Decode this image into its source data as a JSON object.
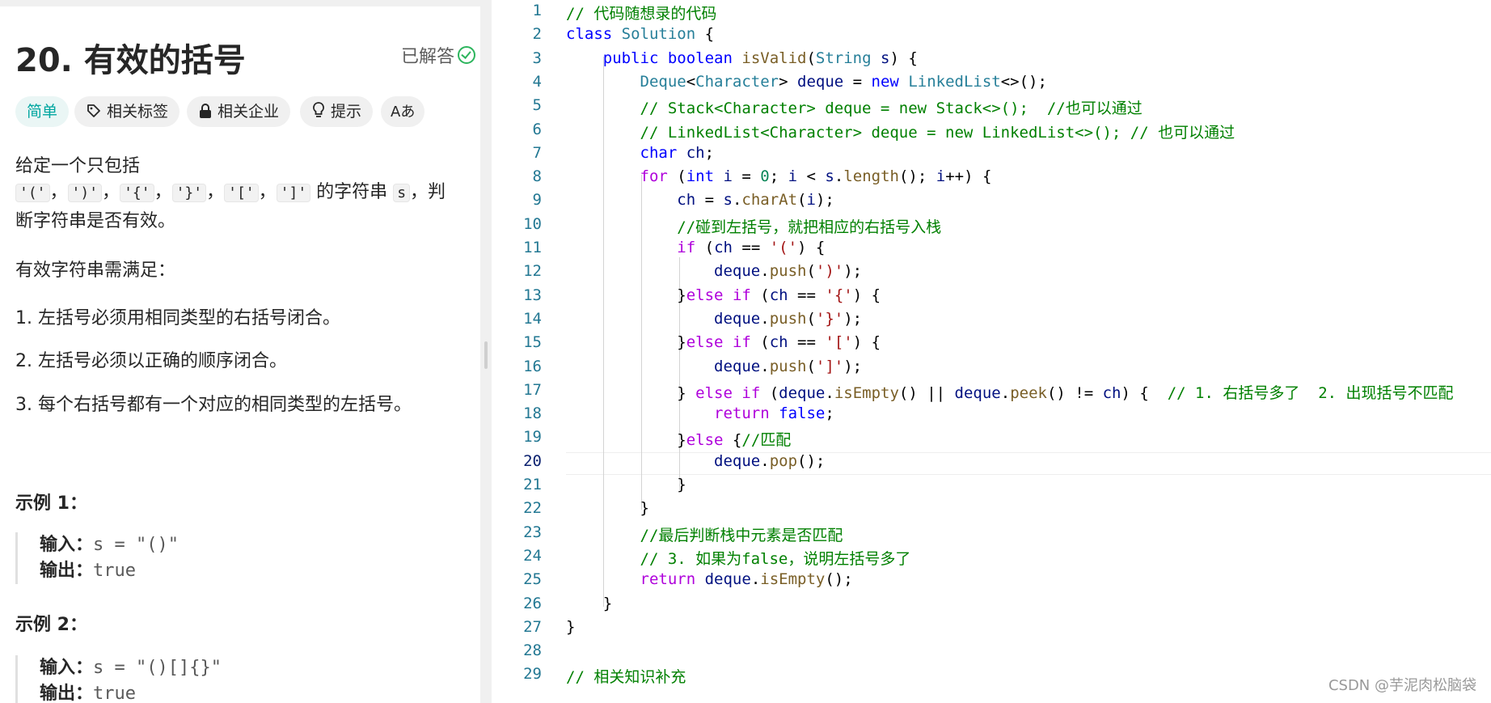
{
  "problem": {
    "title": "20. 有效的括号",
    "solved_label": "已解答",
    "tags": [
      {
        "label": "简单",
        "icon": "difficulty-easy"
      },
      {
        "label": "相关标签",
        "icon": "tag-icon"
      },
      {
        "label": "相关企业",
        "icon": "lock-icon"
      },
      {
        "label": "提示",
        "icon": "bulb-icon"
      },
      {
        "label": "Aあ",
        "icon": "translate-icon"
      }
    ],
    "desc_line1": "给定一个只包括",
    "chars": [
      "'('",
      "')'",
      "'{'",
      "'}'",
      "'['",
      "']'"
    ],
    "sep": "，",
    "desc_string": "的字符串",
    "desc_s": "s",
    "desc_judge": "，判",
    "desc_line3": "断字符串是否有效。",
    "requirement_title": "有效字符串需满足：",
    "rules": [
      "1. 左括号必须用相同类型的右括号闭合。",
      "2. 左括号必须以正确的顺序闭合。",
      "3. 每个右括号都有一个对应的相同类型的左括号。"
    ],
    "examples": [
      {
        "title": "示例 1：",
        "input_label": "输入：",
        "input": "s = \"()\"",
        "output_label": "输出：",
        "output": "true"
      },
      {
        "title": "示例 2：",
        "input_label": "输入：",
        "input": "s = \"()[]{}\"",
        "output_label": "输出：",
        "output": "true"
      }
    ]
  },
  "editor": {
    "current_line": 20,
    "lines": [
      {
        "n": "1",
        "t": [
          {
            "c": "cm",
            "s": "// 代码随想录的代码"
          }
        ]
      },
      {
        "n": "2",
        "t": [
          {
            "c": "kw",
            "s": "class"
          },
          {
            "c": "",
            "s": " "
          },
          {
            "c": "ty",
            "s": "Solution"
          },
          {
            "c": "",
            "s": " {"
          }
        ]
      },
      {
        "n": "3",
        "t": [
          {
            "c": "",
            "s": "    "
          },
          {
            "c": "kw",
            "s": "public"
          },
          {
            "c": "",
            "s": " "
          },
          {
            "c": "kw",
            "s": "boolean"
          },
          {
            "c": "",
            "s": " "
          },
          {
            "c": "fn",
            "s": "isValid"
          },
          {
            "c": "",
            "s": "("
          },
          {
            "c": "ty",
            "s": "String"
          },
          {
            "c": "",
            "s": " "
          },
          {
            "c": "vr",
            "s": "s"
          },
          {
            "c": "",
            "s": ") {"
          }
        ]
      },
      {
        "n": "4",
        "t": [
          {
            "c": "",
            "s": "        "
          },
          {
            "c": "ty",
            "s": "Deque"
          },
          {
            "c": "",
            "s": "<"
          },
          {
            "c": "ty",
            "s": "Character"
          },
          {
            "c": "",
            "s": "> "
          },
          {
            "c": "vr",
            "s": "deque"
          },
          {
            "c": "",
            "s": " = "
          },
          {
            "c": "kw",
            "s": "new"
          },
          {
            "c": "",
            "s": " "
          },
          {
            "c": "ty",
            "s": "LinkedList"
          },
          {
            "c": "",
            "s": "<>();"
          }
        ]
      },
      {
        "n": "5",
        "t": [
          {
            "c": "",
            "s": "        "
          },
          {
            "c": "cm",
            "s": "// Stack<Character> deque = new Stack<>();  //也可以通过"
          }
        ]
      },
      {
        "n": "6",
        "t": [
          {
            "c": "",
            "s": "        "
          },
          {
            "c": "cm",
            "s": "// LinkedList<Character> deque = new LinkedList<>(); // 也可以通过"
          }
        ]
      },
      {
        "n": "7",
        "t": [
          {
            "c": "",
            "s": "        "
          },
          {
            "c": "kw",
            "s": "char"
          },
          {
            "c": "",
            "s": " "
          },
          {
            "c": "vr",
            "s": "ch"
          },
          {
            "c": "",
            "s": ";"
          }
        ]
      },
      {
        "n": "8",
        "t": [
          {
            "c": "",
            "s": "        "
          },
          {
            "c": "kp",
            "s": "for"
          },
          {
            "c": "",
            "s": " ("
          },
          {
            "c": "kw",
            "s": "int"
          },
          {
            "c": "",
            "s": " "
          },
          {
            "c": "vr",
            "s": "i"
          },
          {
            "c": "",
            "s": " = "
          },
          {
            "c": "nu",
            "s": "0"
          },
          {
            "c": "",
            "s": "; "
          },
          {
            "c": "vr",
            "s": "i"
          },
          {
            "c": "",
            "s": " < "
          },
          {
            "c": "vr",
            "s": "s"
          },
          {
            "c": "",
            "s": "."
          },
          {
            "c": "fn",
            "s": "length"
          },
          {
            "c": "",
            "s": "(); "
          },
          {
            "c": "vr",
            "s": "i"
          },
          {
            "c": "",
            "s": "++) {"
          }
        ]
      },
      {
        "n": "9",
        "t": [
          {
            "c": "",
            "s": "            "
          },
          {
            "c": "vr",
            "s": "ch"
          },
          {
            "c": "",
            "s": " = "
          },
          {
            "c": "vr",
            "s": "s"
          },
          {
            "c": "",
            "s": "."
          },
          {
            "c": "fn",
            "s": "charAt"
          },
          {
            "c": "",
            "s": "("
          },
          {
            "c": "vr",
            "s": "i"
          },
          {
            "c": "",
            "s": ");"
          }
        ]
      },
      {
        "n": "10",
        "t": [
          {
            "c": "",
            "s": "            "
          },
          {
            "c": "cm",
            "s": "//碰到左括号，就把相应的右括号入栈"
          }
        ]
      },
      {
        "n": "11",
        "t": [
          {
            "c": "",
            "s": "            "
          },
          {
            "c": "kp",
            "s": "if"
          },
          {
            "c": "",
            "s": " ("
          },
          {
            "c": "vr",
            "s": "ch"
          },
          {
            "c": "",
            "s": " == "
          },
          {
            "c": "st",
            "s": "'('"
          },
          {
            "c": "",
            "s": ") {"
          }
        ]
      },
      {
        "n": "12",
        "t": [
          {
            "c": "",
            "s": "                "
          },
          {
            "c": "vr",
            "s": "deque"
          },
          {
            "c": "",
            "s": "."
          },
          {
            "c": "fn",
            "s": "push"
          },
          {
            "c": "",
            "s": "("
          },
          {
            "c": "st",
            "s": "')'"
          },
          {
            "c": "",
            "s": ");"
          }
        ]
      },
      {
        "n": "13",
        "t": [
          {
            "c": "",
            "s": "            }"
          },
          {
            "c": "kp",
            "s": "else"
          },
          {
            "c": "",
            "s": " "
          },
          {
            "c": "kp",
            "s": "if"
          },
          {
            "c": "",
            "s": " ("
          },
          {
            "c": "vr",
            "s": "ch"
          },
          {
            "c": "",
            "s": " == "
          },
          {
            "c": "st",
            "s": "'{'"
          },
          {
            "c": "",
            "s": ") {"
          }
        ]
      },
      {
        "n": "14",
        "t": [
          {
            "c": "",
            "s": "                "
          },
          {
            "c": "vr",
            "s": "deque"
          },
          {
            "c": "",
            "s": "."
          },
          {
            "c": "fn",
            "s": "push"
          },
          {
            "c": "",
            "s": "("
          },
          {
            "c": "st",
            "s": "'}'"
          },
          {
            "c": "",
            "s": ");"
          }
        ]
      },
      {
        "n": "15",
        "t": [
          {
            "c": "",
            "s": "            }"
          },
          {
            "c": "kp",
            "s": "else"
          },
          {
            "c": "",
            "s": " "
          },
          {
            "c": "kp",
            "s": "if"
          },
          {
            "c": "",
            "s": " ("
          },
          {
            "c": "vr",
            "s": "ch"
          },
          {
            "c": "",
            "s": " == "
          },
          {
            "c": "st",
            "s": "'['"
          },
          {
            "c": "",
            "s": ") {"
          }
        ]
      },
      {
        "n": "16",
        "t": [
          {
            "c": "",
            "s": "                "
          },
          {
            "c": "vr",
            "s": "deque"
          },
          {
            "c": "",
            "s": "."
          },
          {
            "c": "fn",
            "s": "push"
          },
          {
            "c": "",
            "s": "("
          },
          {
            "c": "st",
            "s": "']'"
          },
          {
            "c": "",
            "s": ");"
          }
        ]
      },
      {
        "n": "17",
        "t": [
          {
            "c": "",
            "s": "            } "
          },
          {
            "c": "kp",
            "s": "else"
          },
          {
            "c": "",
            "s": " "
          },
          {
            "c": "kp",
            "s": "if"
          },
          {
            "c": "",
            "s": " ("
          },
          {
            "c": "vr",
            "s": "deque"
          },
          {
            "c": "",
            "s": "."
          },
          {
            "c": "fn",
            "s": "isEmpty"
          },
          {
            "c": "",
            "s": "() || "
          },
          {
            "c": "vr",
            "s": "deque"
          },
          {
            "c": "",
            "s": "."
          },
          {
            "c": "fn",
            "s": "peek"
          },
          {
            "c": "",
            "s": "() != "
          },
          {
            "c": "vr",
            "s": "ch"
          },
          {
            "c": "",
            "s": ") {  "
          },
          {
            "c": "cm",
            "s": "// 1. 右括号多了  2. 出现括号不匹配"
          }
        ]
      },
      {
        "n": "18",
        "t": [
          {
            "c": "",
            "s": "                "
          },
          {
            "c": "kp",
            "s": "return"
          },
          {
            "c": "",
            "s": " "
          },
          {
            "c": "kw",
            "s": "false"
          },
          {
            "c": "",
            "s": ";"
          }
        ]
      },
      {
        "n": "19",
        "t": [
          {
            "c": "",
            "s": "            }"
          },
          {
            "c": "kp",
            "s": "else"
          },
          {
            "c": "",
            "s": " {"
          },
          {
            "c": "cm",
            "s": "//匹配"
          }
        ]
      },
      {
        "n": "20",
        "t": [
          {
            "c": "",
            "s": "                "
          },
          {
            "c": "vr",
            "s": "deque"
          },
          {
            "c": "",
            "s": "."
          },
          {
            "c": "fn",
            "s": "pop"
          },
          {
            "c": "",
            "s": "();"
          }
        ]
      },
      {
        "n": "21",
        "t": [
          {
            "c": "",
            "s": "            }"
          }
        ]
      },
      {
        "n": "22",
        "t": [
          {
            "c": "",
            "s": "        }"
          }
        ]
      },
      {
        "n": "23",
        "t": [
          {
            "c": "",
            "s": "        "
          },
          {
            "c": "cm",
            "s": "//最后判断栈中元素是否匹配"
          }
        ]
      },
      {
        "n": "24",
        "t": [
          {
            "c": "",
            "s": "        "
          },
          {
            "c": "cm",
            "s": "// 3. 如果为false，说明左括号多了"
          }
        ]
      },
      {
        "n": "25",
        "t": [
          {
            "c": "",
            "s": "        "
          },
          {
            "c": "kp",
            "s": "return"
          },
          {
            "c": "",
            "s": " "
          },
          {
            "c": "vr",
            "s": "deque"
          },
          {
            "c": "",
            "s": "."
          },
          {
            "c": "fn",
            "s": "isEmpty"
          },
          {
            "c": "",
            "s": "();"
          }
        ]
      },
      {
        "n": "26",
        "t": [
          {
            "c": "",
            "s": "    }"
          }
        ]
      },
      {
        "n": "27",
        "t": [
          {
            "c": "",
            "s": "}"
          }
        ]
      },
      {
        "n": "28",
        "t": []
      },
      {
        "n": "29",
        "t": [
          {
            "c": "cm",
            "s": "// 相关知识补充"
          }
        ]
      }
    ]
  },
  "watermark": "CSDN @芋泥肉松脑袋",
  "colors": {
    "easy_tag": "#00a6a0",
    "solved_check": "#2db55d",
    "line_number": "#237893"
  }
}
